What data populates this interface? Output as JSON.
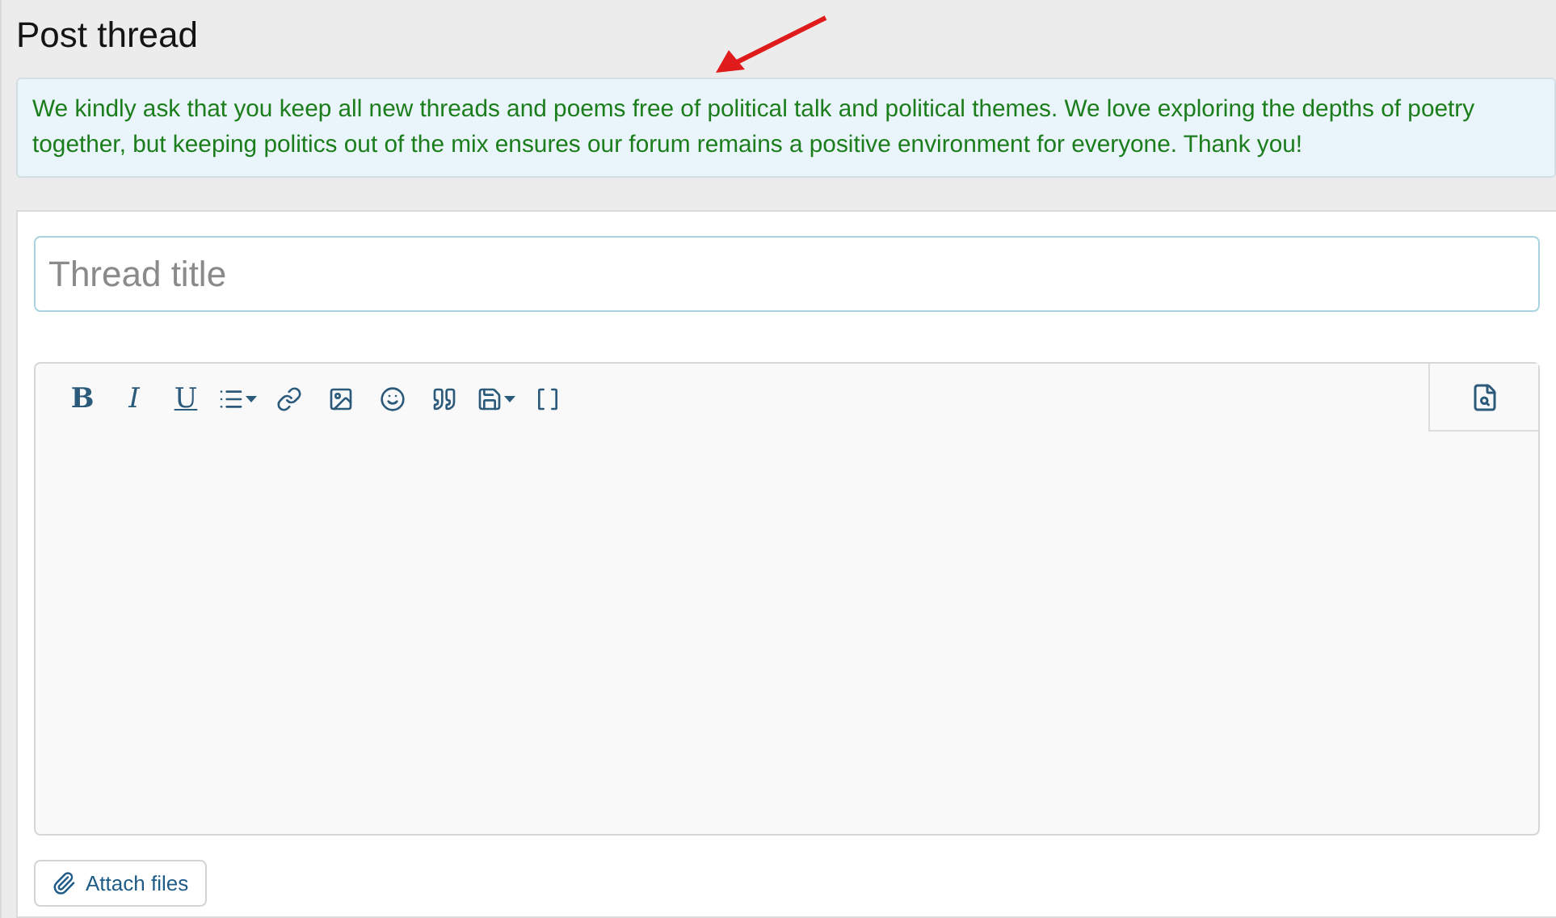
{
  "page": {
    "title": "Post thread"
  },
  "notice": {
    "text": "We kindly ask that you keep all new threads and poems free of political talk and political themes. We love exploring the depths of poetry together, but keeping politics out of the mix ensures our forum remains a positive environment for everyone. Thank you!"
  },
  "title_field": {
    "placeholder": "Thread title"
  },
  "toolbar": [
    {
      "kind": "bold",
      "label": "B",
      "dropdown": false
    },
    {
      "kind": "italic",
      "label": "I",
      "dropdown": false
    },
    {
      "kind": "underline",
      "label": "U",
      "dropdown": false
    },
    {
      "kind": "list",
      "dropdown": true
    },
    {
      "kind": "link",
      "dropdown": false
    },
    {
      "kind": "image",
      "dropdown": false
    },
    {
      "kind": "emoji",
      "dropdown": false
    },
    {
      "kind": "quote",
      "dropdown": false
    },
    {
      "kind": "save",
      "dropdown": true
    },
    {
      "kind": "code",
      "dropdown": false
    }
  ],
  "attach_button": {
    "label": "Attach files"
  }
}
